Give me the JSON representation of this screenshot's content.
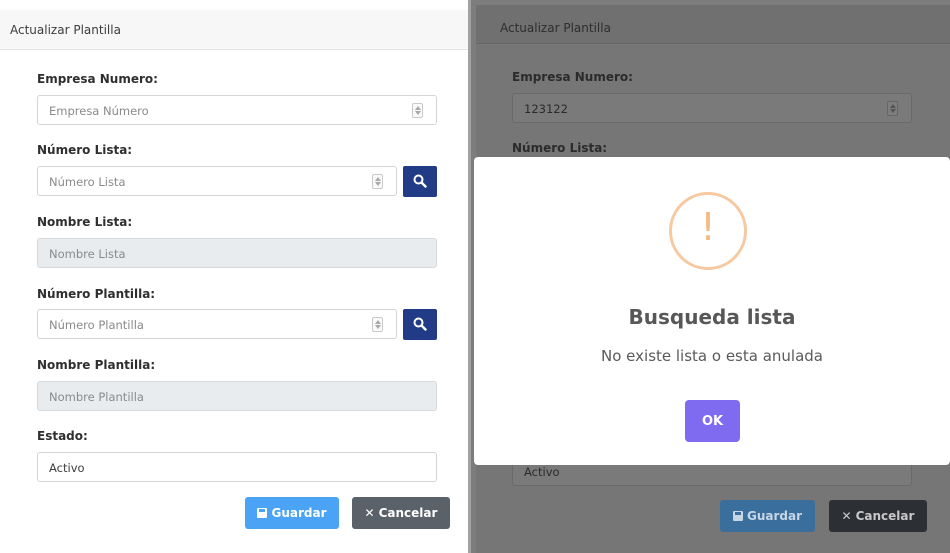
{
  "left_form": {
    "title": "Actualizar Plantilla",
    "fields": {
      "empresa": {
        "label": "Empresa Numero:",
        "placeholder": "Empresa Número"
      },
      "numero_lista": {
        "label": "Número Lista:",
        "placeholder": "Número Lista"
      },
      "nombre_lista": {
        "label": "Nombre Lista:",
        "placeholder": "Nombre Lista"
      },
      "numero_plantilla": {
        "label": "Número Plantilla:",
        "placeholder": "Número Plantilla"
      },
      "nombre_plantilla": {
        "label": "Nombre Plantilla:",
        "placeholder": "Nombre Plantilla"
      },
      "estado": {
        "label": "Estado:",
        "value": "Activo"
      }
    },
    "buttons": {
      "save": "Guardar",
      "cancel": "Cancelar"
    }
  },
  "right_form": {
    "title": "Actualizar Plantilla",
    "empresa": {
      "label": "Empresa Numero:",
      "value": "123122"
    },
    "numero_lista": {
      "label": "Número Lista:"
    },
    "estado": {
      "value": "Activo"
    },
    "buttons": {
      "save": "Guardar",
      "cancel": "Cancelar"
    }
  },
  "alert": {
    "icon": "warning-icon",
    "icon_symbol": "!",
    "title": "Busqueda lista",
    "message": "No existe lista o esta anulada",
    "ok_label": "OK"
  },
  "colors": {
    "search_button": "#213b86",
    "save_button": "#4aa3f5",
    "cancel_button": "#5b6169",
    "ok_button": "#7e6bf0",
    "warning": "#f4b985"
  },
  "icons": {
    "save": "floppy-disk-icon",
    "cancel": "x-icon",
    "search": "magnifier-icon"
  }
}
